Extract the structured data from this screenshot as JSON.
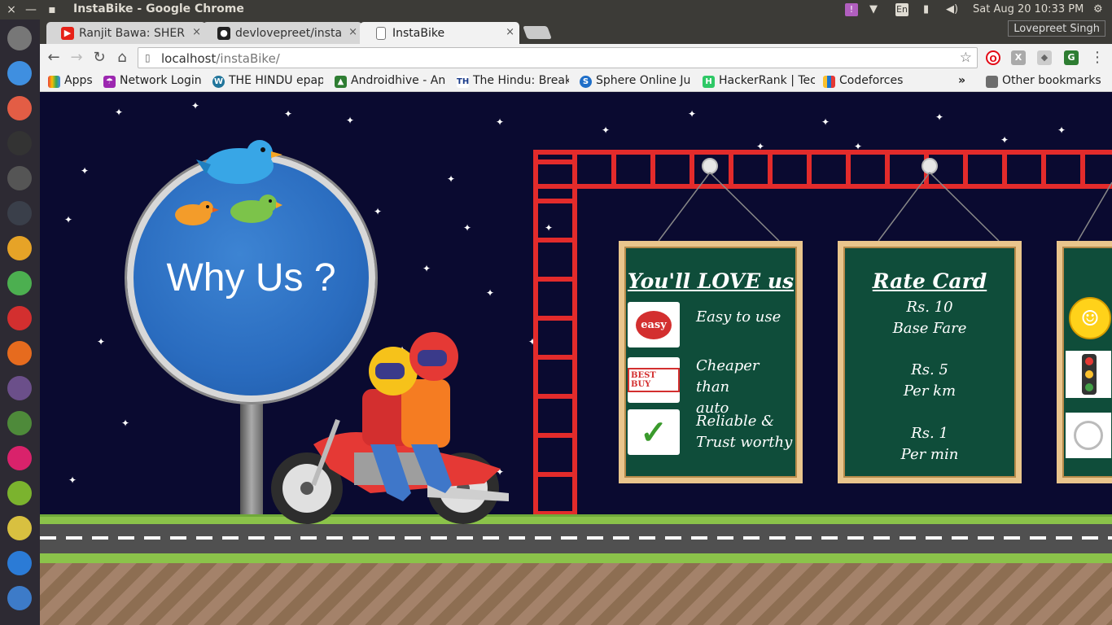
{
  "os": {
    "window_title": "InstaBike - Google Chrome",
    "clock": "Sat Aug 20 10:33 PM",
    "keyboard": "En",
    "close_glyph": "×",
    "minimize_glyph": "—",
    "maximize_glyph": "▪"
  },
  "launcher": {
    "apps": [
      {
        "name": "apple-icon",
        "color": "#777777"
      },
      {
        "name": "dots-app-icon",
        "color": "#3f8fe0"
      },
      {
        "name": "pie-app-icon",
        "color": "#e35d45"
      },
      {
        "name": "terminal-icon",
        "color": "#333333"
      },
      {
        "name": "grid-app-icon",
        "color": "#555555"
      },
      {
        "name": "terminal2-icon",
        "color": "#3a3f4a"
      },
      {
        "name": "files-icon",
        "color": "#e6a327"
      },
      {
        "name": "chrome-icon",
        "color": "#4caf50"
      },
      {
        "name": "vivaldi-icon",
        "color": "#d32f2f"
      },
      {
        "name": "firefox-icon",
        "color": "#e66b1e"
      },
      {
        "name": "atom-icon",
        "color": "#6b4f8a"
      },
      {
        "name": "android-studio-icon",
        "color": "#4e8a3a"
      },
      {
        "name": "flickr-icon",
        "color": "#d9226b"
      },
      {
        "name": "android-icon",
        "color": "#7bb32e"
      },
      {
        "name": "archive-icon",
        "color": "#d8c040"
      },
      {
        "name": "r-app-icon",
        "color": "#2b7bd6"
      },
      {
        "name": "store-icon",
        "color": "#3d7bc8"
      }
    ]
  },
  "chrome": {
    "profile": "Lovepreet Singh",
    "tabs": [
      {
        "title": "Ranjit Bawa: SHER",
        "favicon_color": "#e62117",
        "close": "×"
      },
      {
        "title": "devlovepreet/insta",
        "favicon_color": "#222222",
        "close": "×"
      },
      {
        "title": "InstaBike",
        "favicon_color": "#ffffff",
        "close": "×"
      }
    ],
    "url_host": "localhost",
    "url_path": "/instaBike/",
    "nav": {
      "back": "←",
      "forward": "→",
      "reload": "↻",
      "home": "⌂",
      "star": "☆",
      "menu": "⋮",
      "page": "▯"
    },
    "bookmarks": [
      {
        "label": "Apps",
        "icon_color": "#e94235"
      },
      {
        "label": "Network Login",
        "icon_color": "#9c27b0"
      },
      {
        "label": "THE HINDU epap",
        "icon_color": "#21759b"
      },
      {
        "label": "Androidhive - An",
        "icon_color": "#2e7d32"
      },
      {
        "label": "The Hindu: Break",
        "icon_color": "#1a3b8a"
      },
      {
        "label": "Sphere Online Ju",
        "icon_color": "#1e6ec8"
      },
      {
        "label": "HackerRank | Tec",
        "icon_color": "#2ec866"
      },
      {
        "label": "Codeforces",
        "icon_color": "#1976d2"
      }
    ],
    "bookmarks_overflow": "»",
    "other_bookmarks": "Other bookmarks"
  },
  "page": {
    "sign_text": "Why Us ?",
    "board1": {
      "title": "You'll LOVE us",
      "features": [
        {
          "badge": "easy",
          "text_line1": "Easy to use",
          "text_line2": ""
        },
        {
          "badge": "BEST BUY",
          "text_line1": "Cheaper than",
          "text_line2": "auto"
        },
        {
          "badge": "✓",
          "text_line1": "Reliable &",
          "text_line2": "Trust worthy"
        }
      ]
    },
    "board2": {
      "title": "Rate Card",
      "lines": [
        "Rs. 10",
        "Base Fare",
        "Rs. 5",
        "Per km",
        "Rs. 1",
        "Per min"
      ]
    },
    "board3": {
      "icons": [
        "smiley-icon",
        "traffic-light-icon",
        "touch-icon"
      ]
    }
  }
}
